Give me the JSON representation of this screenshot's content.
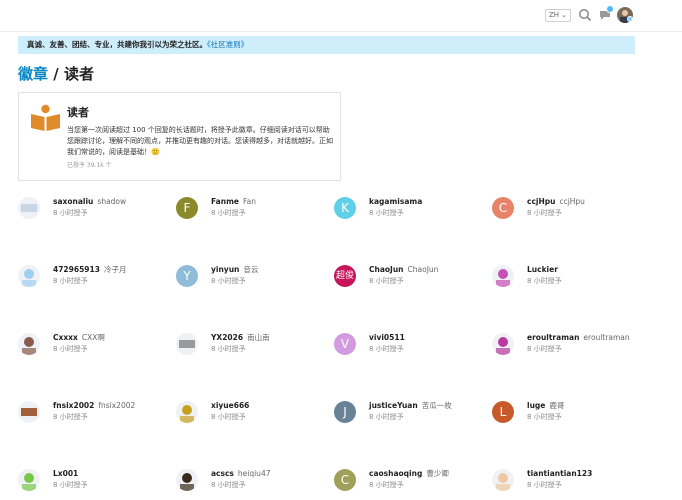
{
  "header": {
    "lang": "ZH"
  },
  "banner": {
    "text": "真诚、友善、团结、专业，共建你我引以为荣之社区。",
    "link": "《社区准则》"
  },
  "title": {
    "link": "徽章",
    "sep": " / ",
    "current": "读者"
  },
  "badge": {
    "name": "读者",
    "description": "当您第一次阅读超过 100 个回复的长话题时，将授予此徽章。仔细阅读对话可以帮助您跟踪讨论，理解不同的观点，并推动更有趣的对话。您读得越多，对话就越好。正如我们常说的，阅读是基础！🙂",
    "granted_count": "已授予 39.1k 个"
  },
  "users": [
    {
      "username": "saxonaliu",
      "name": "shadow",
      "time": "8 小时授予",
      "avatar": "img",
      "color": "#c9d6e3"
    },
    {
      "username": "Fanme",
      "name": "Fan",
      "time": "8 小时授予",
      "avatar": "F",
      "color": "#8a8a2a"
    },
    {
      "username": "kagamisama",
      "name": "",
      "time": "8 小时授予",
      "avatar": "K",
      "color": "#5fd0e8"
    },
    {
      "username": "ccjHpu",
      "name": "ccjHpu",
      "time": "8 小时授予",
      "avatar": "C",
      "color": "#e8836a"
    },
    {
      "username": "472965913",
      "name": "冷子月",
      "time": "8 小时授予",
      "avatar": "img",
      "color": "#9fd0f0"
    },
    {
      "username": "yinyun",
      "name": "音云",
      "time": "8 小时授予",
      "avatar": "Y",
      "color": "#8fbcd8"
    },
    {
      "username": "ChaoJun",
      "name": "ChaoJun",
      "time": "8 小时授予",
      "avatar": "超俊",
      "color": "#c8145a"
    },
    {
      "username": "Luckier",
      "name": "",
      "time": "8 小时授予",
      "avatar": "img",
      "color": "#c84fb4"
    },
    {
      "username": "Cxxxx",
      "name": "CXX啊",
      "time": "8 小时授予",
      "avatar": "img",
      "color": "#8a5a4a"
    },
    {
      "username": "YX2026",
      "name": "南山南",
      "time": "8 小时授予",
      "avatar": "img",
      "color": "#9a9a9a"
    },
    {
      "username": "vivi0511",
      "name": "",
      "time": "8 小时授予",
      "avatar": "V",
      "color": "#d29be0"
    },
    {
      "username": "eroultraman",
      "name": "eroultraman",
      "time": "8 小时授予",
      "avatar": "img",
      "color": "#b83aa0"
    },
    {
      "username": "fnsix2002",
      "name": "fnsix2002",
      "time": "8 小时授予",
      "avatar": "img",
      "color": "#a0603a"
    },
    {
      "username": "xiyue666",
      "name": "",
      "time": "8 小时授予",
      "avatar": "img",
      "color": "#c8a020"
    },
    {
      "username": "justiceYuan",
      "name": "苦瓜一枚",
      "time": "8 小时授予",
      "avatar": "J",
      "color": "#6a8298"
    },
    {
      "username": "luge",
      "name": "鹿哥",
      "time": "8 小时授予",
      "avatar": "L",
      "color": "#c85a2a"
    },
    {
      "username": "Lx001",
      "name": "",
      "time": "8 小时授予",
      "avatar": "img",
      "color": "#7ac84a"
    },
    {
      "username": "acscs",
      "name": "heiqiu47",
      "time": "8 小时授予",
      "avatar": "img",
      "color": "#3a2a1a"
    },
    {
      "username": "caoshaoqing",
      "name": "曹少卿",
      "time": "8 小时授予",
      "avatar": "C",
      "color": "#a0a05a"
    },
    {
      "username": "tiantiantian123",
      "name": "",
      "time": "8 小时授予",
      "avatar": "img",
      "color": "#f0c8a0"
    }
  ]
}
